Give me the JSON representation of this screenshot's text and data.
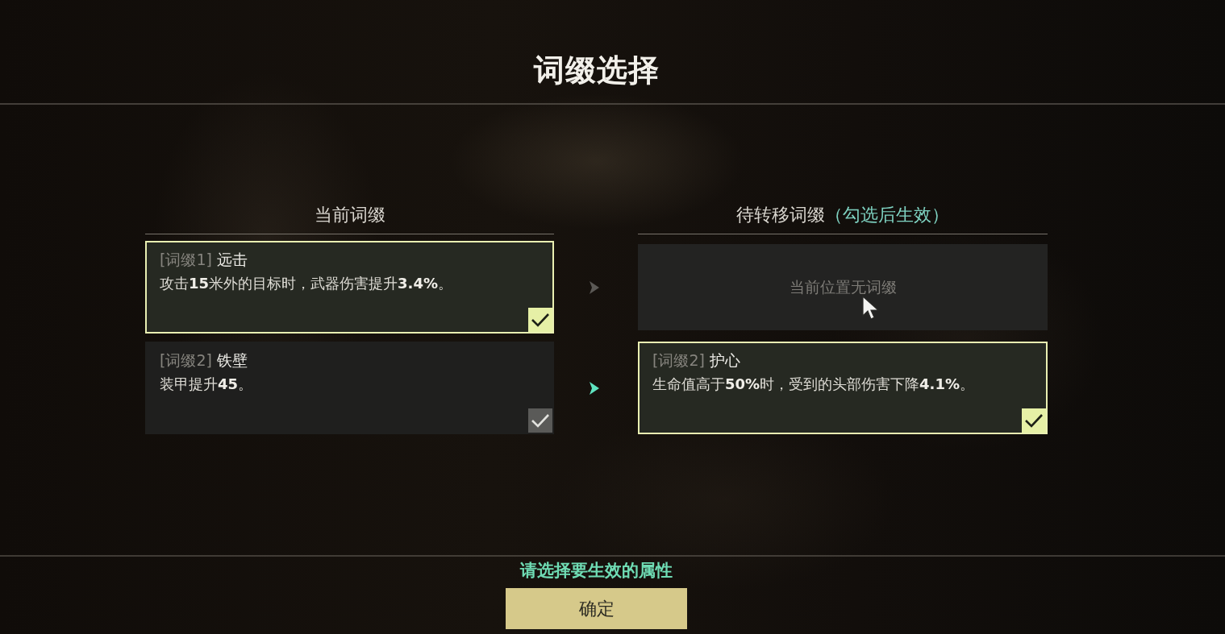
{
  "title": "词缀选择",
  "current_affixes": {
    "heading": "当前词缀",
    "items": [
      {
        "tag": "[词缀1]",
        "name": "远击",
        "description": "攻击**15**米外的目标时，武器伤害提升**3.4%**。",
        "checked": true
      },
      {
        "tag": "[词缀2]",
        "name": "铁壁",
        "description": "装甲提升**45**。",
        "checked": false
      }
    ]
  },
  "transfer_arrows": [
    {
      "active": false
    },
    {
      "active": true
    }
  ],
  "pending_affixes": {
    "heading": "待转移词缀",
    "heading_note": "（勾选后生效）",
    "slots": [
      {
        "kind": "empty",
        "text": "当前位置无词缀"
      },
      {
        "kind": "affix",
        "tag": "[词缀2]",
        "name": "护心",
        "description": "生命值高于**50%**时，受到的头部伤害下降**4.1%**。",
        "checked": true
      }
    ]
  },
  "prompt": "请选择要生效的属性",
  "confirm_button": "确定"
}
